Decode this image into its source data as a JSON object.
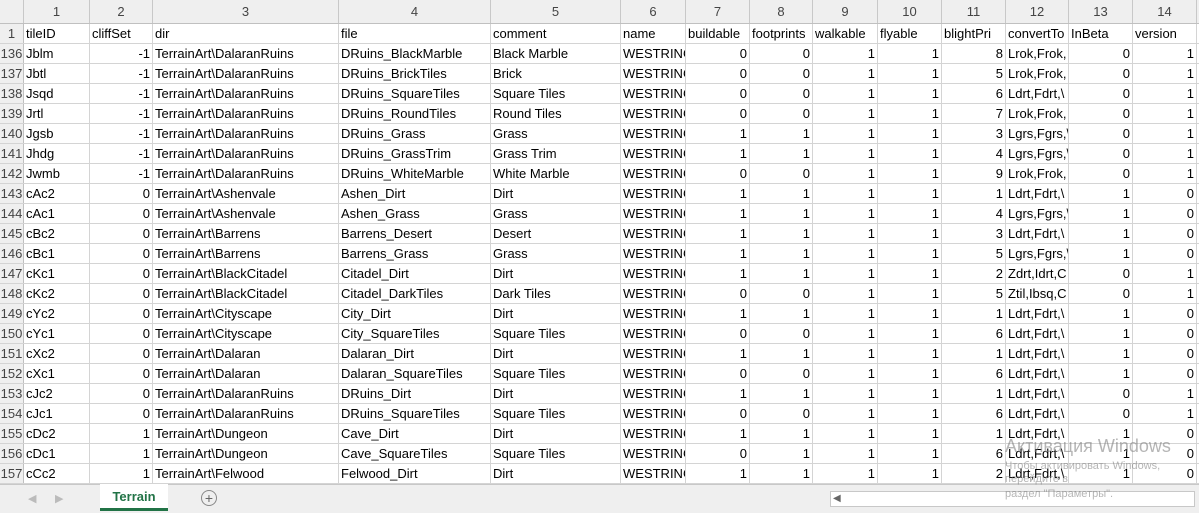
{
  "column_numbers": [
    "1",
    "2",
    "3",
    "4",
    "5",
    "6",
    "7",
    "8",
    "9",
    "10",
    "11",
    "12",
    "13",
    "14"
  ],
  "header_row_number": "1",
  "headers": [
    "tileID",
    "cliffSet",
    "dir",
    "file",
    "comment",
    "name",
    "buildable",
    "footprints",
    "walkable",
    "flyable",
    "blightPri",
    "convertTo",
    "InBeta",
    "version"
  ],
  "rows": [
    [
      "136",
      "Jblm",
      "-1",
      "TerrainArt\\DalaranRuins",
      "DRuins_BlackMarble",
      "Black Marble",
      "WESTRING",
      "0",
      "0",
      "1",
      "1",
      "8",
      "Lrok,Frok,",
      "0",
      "1"
    ],
    [
      "137",
      "Jbtl",
      "-1",
      "TerrainArt\\DalaranRuins",
      "DRuins_BrickTiles",
      "Brick",
      "WESTRING",
      "0",
      "0",
      "1",
      "1",
      "5",
      "Lrok,Frok,",
      "0",
      "1"
    ],
    [
      "138",
      "Jsqd",
      "-1",
      "TerrainArt\\DalaranRuins",
      "DRuins_SquareTiles",
      "Square Tiles",
      "WESTRING",
      "0",
      "0",
      "1",
      "1",
      "6",
      "Ldrt,Fdrt,\\",
      "0",
      "1"
    ],
    [
      "139",
      "Jrtl",
      "-1",
      "TerrainArt\\DalaranRuins",
      "DRuins_RoundTiles",
      "Round Tiles",
      "WESTRING",
      "0",
      "0",
      "1",
      "1",
      "7",
      "Lrok,Frok,",
      "0",
      "1"
    ],
    [
      "140",
      "Jgsb",
      "-1",
      "TerrainArt\\DalaranRuins",
      "DRuins_Grass",
      "Grass",
      "WESTRING",
      "1",
      "1",
      "1",
      "1",
      "3",
      "Lgrs,Fgrs,\\",
      "0",
      "1"
    ],
    [
      "141",
      "Jhdg",
      "-1",
      "TerrainArt\\DalaranRuins",
      "DRuins_GrassTrim",
      "Grass Trim",
      "WESTRING",
      "1",
      "1",
      "1",
      "1",
      "4",
      "Lgrs,Fgrs,\\",
      "0",
      "1"
    ],
    [
      "142",
      "Jwmb",
      "-1",
      "TerrainArt\\DalaranRuins",
      "DRuins_WhiteMarble",
      "White Marble",
      "WESTRING",
      "0",
      "0",
      "1",
      "1",
      "9",
      "Lrok,Frok,",
      "0",
      "1"
    ],
    [
      "143",
      "cAc2",
      "0",
      "TerrainArt\\Ashenvale",
      "Ashen_Dirt",
      "Dirt",
      "WESTRING",
      "1",
      "1",
      "1",
      "1",
      "1",
      "Ldrt,Fdrt,\\",
      "1",
      "0"
    ],
    [
      "144",
      "cAc1",
      "0",
      "TerrainArt\\Ashenvale",
      "Ashen_Grass",
      "Grass",
      "WESTRING",
      "1",
      "1",
      "1",
      "1",
      "4",
      "Lgrs,Fgrs,\\",
      "1",
      "0"
    ],
    [
      "145",
      "cBc2",
      "0",
      "TerrainArt\\Barrens",
      "Barrens_Desert",
      "Desert",
      "WESTRING",
      "1",
      "1",
      "1",
      "1",
      "3",
      "Ldrt,Fdrt,\\",
      "1",
      "0"
    ],
    [
      "146",
      "cBc1",
      "0",
      "TerrainArt\\Barrens",
      "Barrens_Grass",
      "Grass",
      "WESTRING",
      "1",
      "1",
      "1",
      "1",
      "5",
      "Lgrs,Fgrs,\\",
      "1",
      "0"
    ],
    [
      "147",
      "cKc1",
      "0",
      "TerrainArt\\BlackCitadel",
      "Citadel_Dirt",
      "Dirt",
      "WESTRING",
      "1",
      "1",
      "1",
      "1",
      "2",
      "Zdrt,Idrt,C",
      "0",
      "1"
    ],
    [
      "148",
      "cKc2",
      "0",
      "TerrainArt\\BlackCitadel",
      "Citadel_DarkTiles",
      "Dark Tiles",
      "WESTRING",
      "0",
      "0",
      "1",
      "1",
      "5",
      "Ztil,Ibsq,C",
      "0",
      "1"
    ],
    [
      "149",
      "cYc2",
      "0",
      "TerrainArt\\Cityscape",
      "City_Dirt",
      "Dirt",
      "WESTRING",
      "1",
      "1",
      "1",
      "1",
      "1",
      "Ldrt,Fdrt,\\",
      "1",
      "0"
    ],
    [
      "150",
      "cYc1",
      "0",
      "TerrainArt\\Cityscape",
      "City_SquareTiles",
      "Square Tiles",
      "WESTRING",
      "0",
      "0",
      "1",
      "1",
      "6",
      "Ldrt,Fdrt,\\",
      "1",
      "0"
    ],
    [
      "151",
      "cXc2",
      "0",
      "TerrainArt\\Dalaran",
      "Dalaran_Dirt",
      "Dirt",
      "WESTRING",
      "1",
      "1",
      "1",
      "1",
      "1",
      "Ldrt,Fdrt,\\",
      "1",
      "0"
    ],
    [
      "152",
      "cXc1",
      "0",
      "TerrainArt\\Dalaran",
      "Dalaran_SquareTiles",
      "Square Tiles",
      "WESTRING",
      "0",
      "0",
      "1",
      "1",
      "6",
      "Ldrt,Fdrt,\\",
      "1",
      "0"
    ],
    [
      "153",
      "cJc2",
      "0",
      "TerrainArt\\DalaranRuins",
      "DRuins_Dirt",
      "Dirt",
      "WESTRING",
      "1",
      "1",
      "1",
      "1",
      "1",
      "Ldrt,Fdrt,\\",
      "0",
      "1"
    ],
    [
      "154",
      "cJc1",
      "0",
      "TerrainArt\\DalaranRuins",
      "DRuins_SquareTiles",
      "Square Tiles",
      "WESTRING",
      "0",
      "0",
      "1",
      "1",
      "6",
      "Ldrt,Fdrt,\\",
      "0",
      "1"
    ],
    [
      "155",
      "cDc2",
      "1",
      "TerrainArt\\Dungeon",
      "Cave_Dirt",
      "Dirt",
      "WESTRING",
      "1",
      "1",
      "1",
      "1",
      "1",
      "Ldrt,Fdrt,\\",
      "1",
      "0"
    ],
    [
      "156",
      "cDc1",
      "1",
      "TerrainArt\\Dungeon",
      "Cave_SquareTiles",
      "Square Tiles",
      "WESTRING",
      "0",
      "1",
      "1",
      "1",
      "6",
      "Ldrt,Fdrt,\\",
      "1",
      "0"
    ],
    [
      "157",
      "cCc2",
      "1",
      "TerrainArt\\Felwood",
      "Felwood_Dirt",
      "Dirt",
      "WESTRING",
      "1",
      "1",
      "1",
      "1",
      "2",
      "Ldrt,Fdrt,\\",
      "1",
      "0"
    ]
  ],
  "sheet_tab": "Terrain",
  "add_sheet_icon": "plus-circle-icon",
  "watermark": {
    "line1": "Активация Windows",
    "line2": "Чтобы активировать Windows, перейдите в",
    "line3": "раздел \"Параметры\"."
  }
}
